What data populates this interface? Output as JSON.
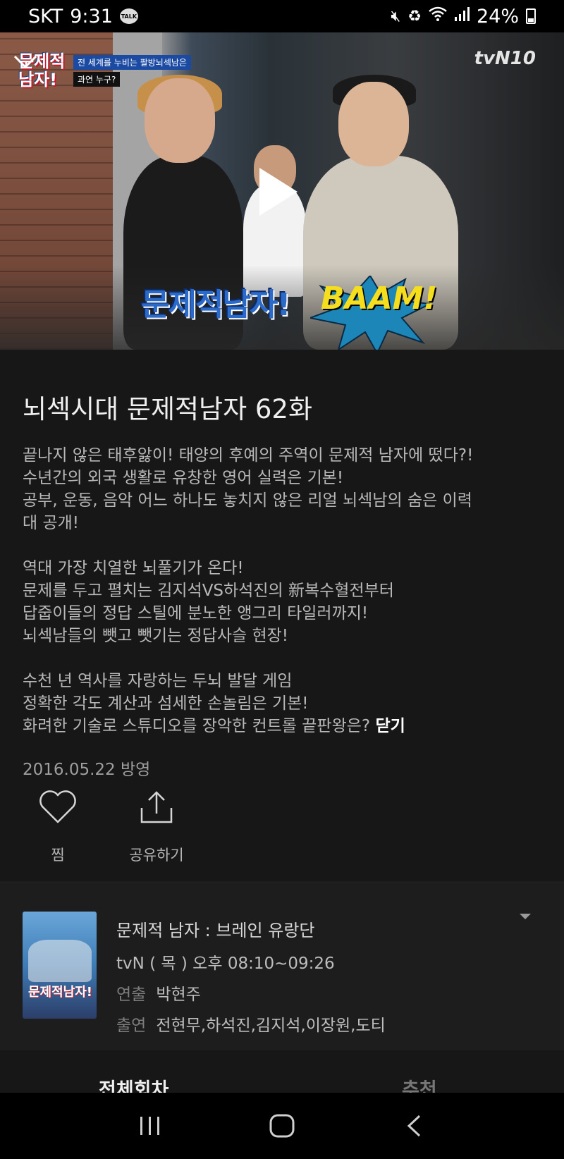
{
  "status_bar": {
    "carrier": "SKT",
    "time": "9:31",
    "talk_badge": "TALK",
    "battery": "24%"
  },
  "video": {
    "channel_logo": "tvN10",
    "top_logo": "문제적 남자!",
    "caption_line1": "전 세계를 누비는 팔방뇌섹남은",
    "caption_line2": "과연 누구?",
    "overlay_logo": "문제적남자!",
    "overlay_sfx": "BAAM!"
  },
  "episode": {
    "title": "뇌섹시대 문제적남자 62화",
    "description": [
      "끝나지 않은 태후앓이! 태양의 후예의 주역이 문제적 남자에 떴다?!",
      "수년간의 외국 생활로 유창한 영어 실력은 기본!",
      "공부, 운동, 음악 어느 하나도 놓치지 않은 리얼 뇌섹남의 숨은 이력",
      "대 공개!",
      "",
      "역대 가장 치열한 뇌풀기가 온다!",
      "문제를 두고 펼치는 김지석VS하석진의 新복수혈전부터",
      "답줍이들의 정답 스틸에 분노한 앵그리 타일러까지!",
      "뇌섹남들의 뺏고 뺏기는 정답사슬 현장!",
      "",
      "수천 년 역사를 자랑하는 두뇌 발달 게임",
      "정확한 각도 계산과 섬세한 손놀림은 기본!",
      "화려한 기술로 스튜디오를 장악한 컨트롤 끝판왕은?"
    ],
    "close_label": "닫기",
    "air_date": "2016.05.22 방영"
  },
  "actions": {
    "like_label": "찜",
    "share_label": "공유하기"
  },
  "program": {
    "title": "문제적 남자 : 브레인 유랑단",
    "schedule": "tvN ( 목 ) 오후 08:10~09:26",
    "director_key": "연출",
    "director": "박현주",
    "cast_key": "출연",
    "cast": "전현무,하석진,김지석,이장원,도티",
    "thumb_logo": "문제적남자!"
  },
  "tabs": {
    "all": "전체회차",
    "recommend": "추천"
  },
  "colors": {
    "background": "#171717",
    "panel": "#1d1d1d",
    "text_primary": "#f0f0f0",
    "text_secondary": "#b8b8b8"
  }
}
